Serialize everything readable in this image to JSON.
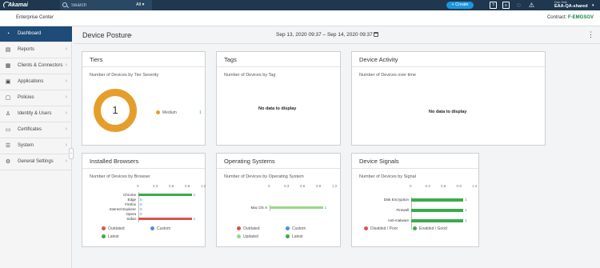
{
  "topbar": {
    "logo": "Akamai",
    "search_placeholder": "Search",
    "scope": "All",
    "create_label": "Create",
    "user_name": "Dan Hall",
    "account": "EAA-QA-shared"
  },
  "subheader": {
    "app_name": "Enterprise Center",
    "contract_label": "Contract:",
    "contract_value": "F-EMGSGV"
  },
  "sidebar": {
    "items": [
      {
        "label": "Dashboard",
        "icon": "gauge-icon"
      },
      {
        "label": "Reports",
        "icon": "chart-icon"
      },
      {
        "label": "Clients & Connectors",
        "icon": "connector-icon"
      },
      {
        "label": "Applications",
        "icon": "applications-icon"
      },
      {
        "label": "Policies",
        "icon": "policy-icon"
      },
      {
        "label": "Identity & Users",
        "icon": "users-icon"
      },
      {
        "label": "Certificates",
        "icon": "certificate-icon"
      },
      {
        "label": "System",
        "icon": "sliders-icon"
      },
      {
        "label": "General Settings",
        "icon": "gear-icon"
      }
    ]
  },
  "main": {
    "title": "Device Posture",
    "date_range": "Sep 13, 2020 09:37 – Sep 14, 2020 09:37"
  },
  "cards": {
    "tiers": {
      "title": "Tiers",
      "subtitle": "Number of Devices by Tier Severity",
      "total": "1",
      "legend": [
        {
          "label": "Medium",
          "value": "1",
          "color": "#e59e2c"
        }
      ]
    },
    "tags": {
      "title": "Tags",
      "subtitle": "Number of Devices by Tag",
      "empty": "No data to display"
    },
    "activity": {
      "title": "Device Activity",
      "subtitle": "Number of Devices over time",
      "empty": "No data to display"
    },
    "browsers": {
      "title": "Installed Browsers",
      "subtitle": "Number of Devices by Browser",
      "ticks": [
        "0",
        "0.3",
        "0.6",
        "0.9",
        "1.2"
      ],
      "legend": [
        {
          "label": "Outdated",
          "color": "#d9534f"
        },
        {
          "label": "Custom",
          "color": "#4a90d9"
        },
        {
          "label": "Latest",
          "color": "#3cab4a"
        }
      ]
    },
    "os": {
      "title": "Operating Systems",
      "subtitle": "Number of Devices by Operating System",
      "ticks": [
        "0",
        "0.3",
        "0.6",
        "0.9",
        "1.2"
      ],
      "legend": [
        {
          "label": "Outdated",
          "color": "#d9534f"
        },
        {
          "label": "Custom",
          "color": "#4a90d9"
        },
        {
          "label": "Updated",
          "color": "#9bd68a"
        },
        {
          "label": "Latest",
          "color": "#3cab4a"
        }
      ]
    },
    "signals": {
      "title": "Device Signals",
      "subtitle": "Number of Devices by Signal",
      "ticks": [
        "0",
        "0.3",
        "0.6",
        "0.9",
        "1.2"
      ],
      "legend": [
        {
          "label": "Disabled / Poor",
          "color": "#d9534f"
        },
        {
          "label": "Enabled / Good",
          "color": "#3cab4a"
        }
      ]
    }
  },
  "chart_data": [
    {
      "type": "pie",
      "title": "Number of Devices by Tier Severity",
      "categories": [
        "Medium"
      ],
      "values": [
        1
      ]
    },
    {
      "type": "bar",
      "title": "Number of Devices by Browser",
      "categories": [
        "Chrome",
        "Edge",
        "Firefox",
        "Internet Explorer",
        "Opera",
        "Safari"
      ],
      "series": [
        {
          "name": "Latest",
          "values": [
            1,
            0,
            0,
            0,
            0,
            0
          ],
          "color": "#3cab4a"
        },
        {
          "name": "Outdated",
          "values": [
            0,
            0,
            0,
            0,
            0,
            1
          ],
          "color": "#d9534f"
        }
      ],
      "labels": [
        "1",
        "0",
        "0",
        "0",
        "0",
        "1"
      ],
      "xlim": [
        0,
        1.2
      ]
    },
    {
      "type": "bar",
      "title": "Number of Devices by Operating System",
      "categories": [
        "Mac OS X"
      ],
      "series": [
        {
          "name": "Updated",
          "values": [
            1
          ],
          "color": "#9bd68a"
        }
      ],
      "labels": [
        "1"
      ],
      "xlim": [
        0,
        1.2
      ]
    },
    {
      "type": "bar",
      "title": "Number of Devices by Signal",
      "categories": [
        "Disk Encryption",
        "Firewall",
        "Anti-malware"
      ],
      "series": [
        {
          "name": "Enabled / Good",
          "values": [
            1,
            1,
            1
          ],
          "color": "#3cab4a"
        }
      ],
      "labels": [
        "1",
        "1",
        "1"
      ],
      "xlim": [
        0,
        1.2
      ]
    }
  ]
}
